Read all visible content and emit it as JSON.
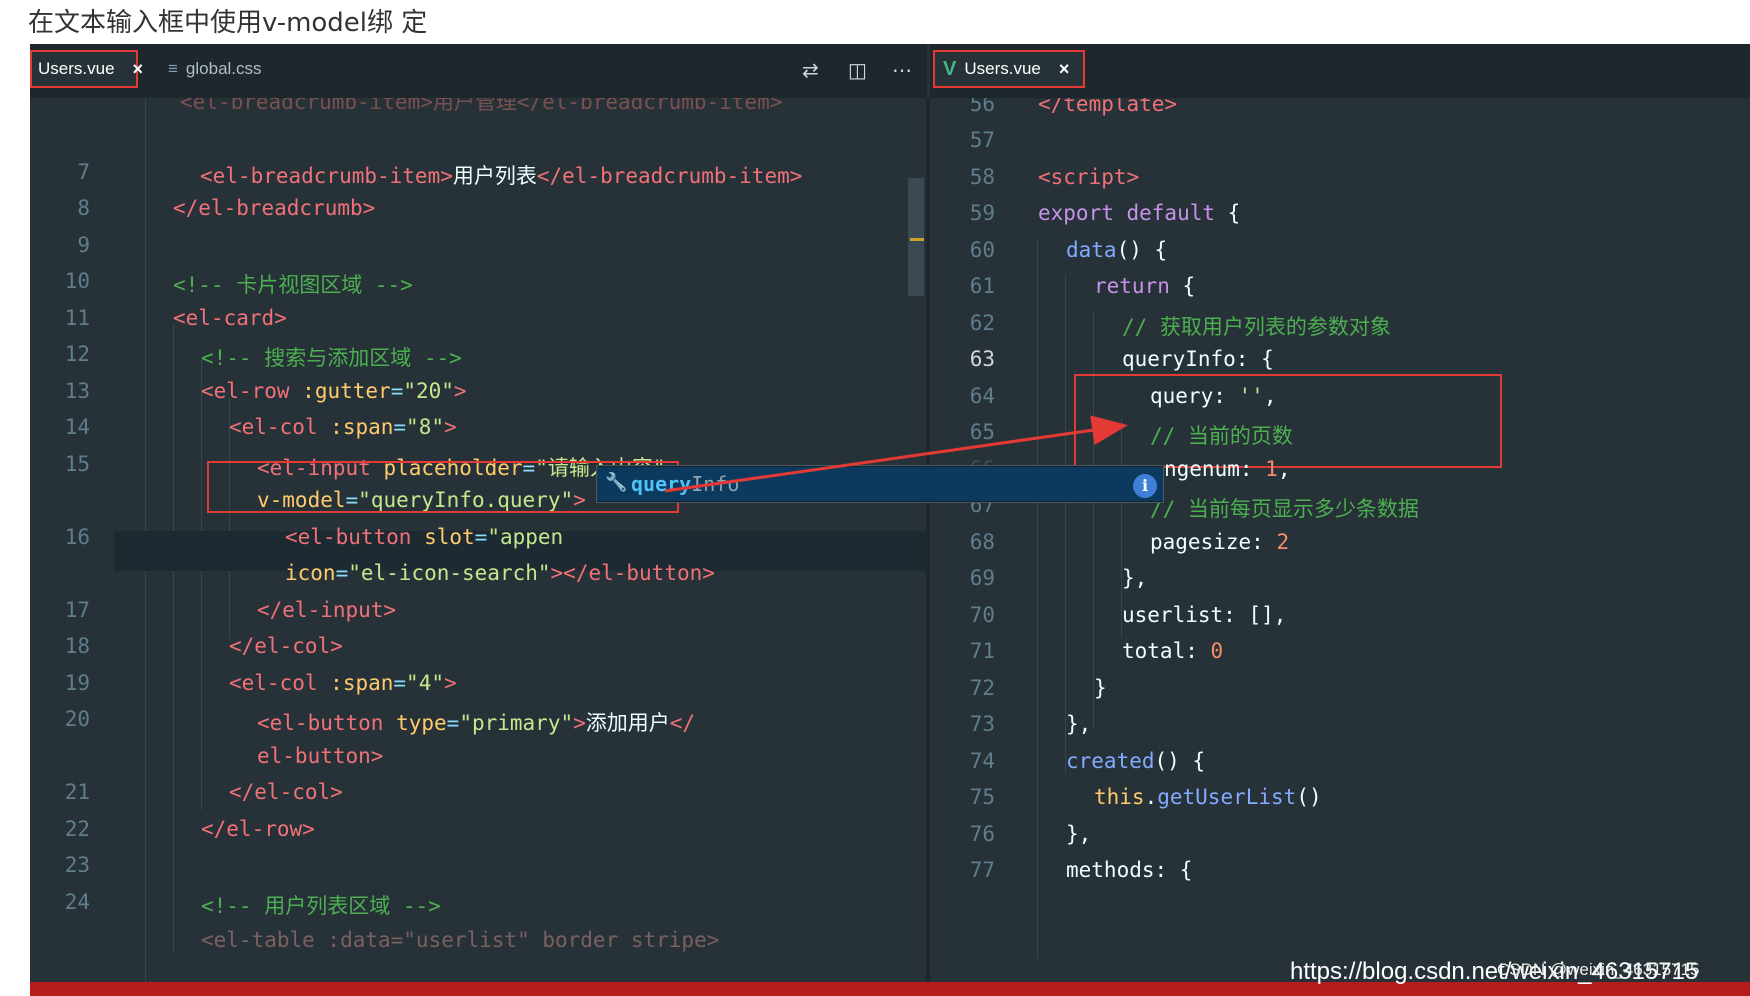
{
  "caption": "在文本输入框中使用v-model绑 定",
  "left_tabs": [
    {
      "label": "Users.vue",
      "close": "×",
      "active": true
    },
    {
      "label": "global.css",
      "icon": "css-file-icon"
    }
  ],
  "right_tabs": [
    {
      "label": "Users.vue",
      "close": "×",
      "active": true,
      "icon": "vue-file-icon"
    }
  ],
  "left_code": {
    "line_numbers": [
      "7",
      "8",
      "9",
      "10",
      "11",
      "12",
      "13",
      "14",
      "15",
      "",
      "16",
      "",
      "17",
      "18",
      "19",
      "20",
      "",
      "21",
      "22",
      "23",
      "24"
    ],
    "l7_open": "<el-breadcrumb-item>",
    "l7_text": "用户列表",
    "l7_close": "</el-breadcrumb-item>",
    "l8": "</el-breadcrumb>",
    "l10": "<!-- 卡片视图区域 -->",
    "l11": "<el-card>",
    "l12": "<!-- 搜索与添加区域 -->",
    "l13_tag": "<el-row",
    "l13_attr": ":gutter",
    "l13_val": "\"20\"",
    "l14_tag": "<el-col",
    "l14_attr": ":span",
    "l14_val": "\"8\"",
    "l15_tag": "<el-input",
    "l15_attr": "placeholder",
    "l15_val": "\"请输入内容\"",
    "l15b_attr": "v-model",
    "l15b_val": "\"queryInfo.query\"",
    "l16_tag": "<el-button",
    "l16_attr": "slot",
    "l16_val": "\"appen",
    "l16b_attr": "icon",
    "l16b_val": "\"el-icon-search\"",
    "l16b_close": "></el-button>",
    "l17": "</el-input>",
    "l18": "</el-col>",
    "l19_tag": "<el-col",
    "l19_attr": ":span",
    "l19_val": "\"4\"",
    "l20_tag": "<el-button",
    "l20_attr": "type",
    "l20_val": "\"primary\"",
    "l20_text": "添加用户",
    "l20_close": "</",
    "l20b": "el-button>",
    "l21": "</el-col>",
    "l22": "</el-row>",
    "l24": "<!-- 用户列表区域 -->"
  },
  "autocomplete": {
    "match": "query",
    "rest": "Info"
  },
  "right_code": {
    "line_numbers": [
      "56",
      "57",
      "58",
      "59",
      "60",
      "61",
      "62",
      "63",
      "64",
      "65",
      "66",
      "67",
      "68",
      "69",
      "70",
      "71",
      "72",
      "73",
      "74",
      "75",
      "76",
      "77"
    ],
    "l56": "</template>",
    "l58": "<script>",
    "l59_k": "export default",
    "l60_f": "data",
    "l61_k": "return",
    "l62": "// 获取用户列表的参数对象",
    "l63": "queryInfo",
    "l64": "query",
    "l64_val": "''",
    "l65": "// 当前的页数",
    "l66": "ngenum",
    "l66_val": "1",
    "l67": "// 当前每页显示多少条数据",
    "l68": "pagesize",
    "l68_val": "2",
    "l70": "userlist",
    "l71": "total",
    "l71_val": "0",
    "l74_f": "created",
    "l75_k": "this",
    "l75_f": "getUserList",
    "l77": "methods"
  },
  "watermark": {
    "url": "https://blog.csdn.net/weixin_46315715",
    "user": "CSDN @weixin_46315715"
  },
  "colors": {
    "tag": "#f07178",
    "attr": "#ffcb6b",
    "string": "#c3e88d",
    "comment": "#4caf50",
    "highlight_box": "#e53935",
    "arrow": "#e53935"
  }
}
